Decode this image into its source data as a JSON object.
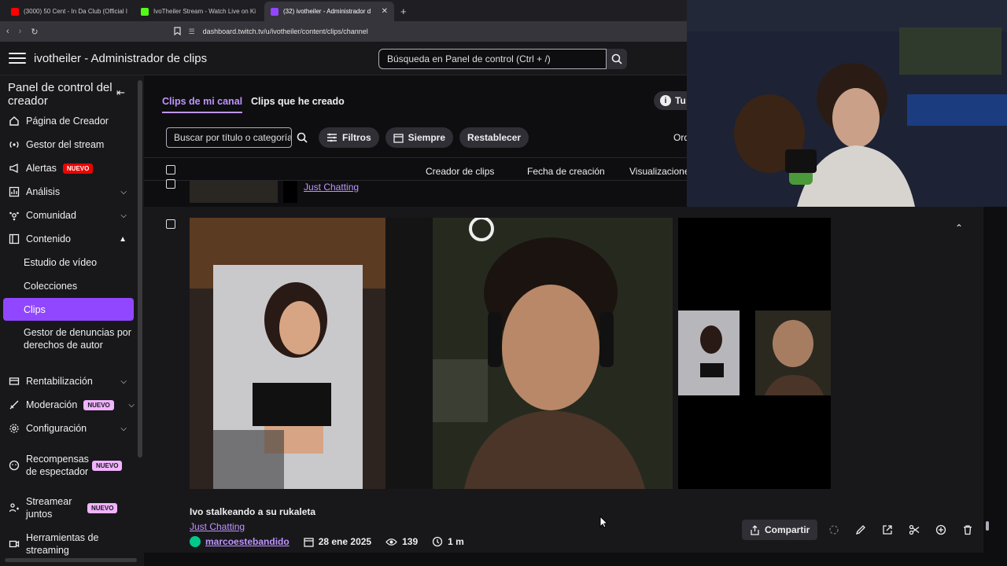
{
  "browser": {
    "tabs": [
      {
        "title": "(3000) 50 Cent - In Da Club (Official I",
        "fav_color": "#ff0000"
      },
      {
        "title": "IvoTheiler Stream - Watch Live on Ki",
        "fav_color": "#53fc18"
      },
      {
        "title": "(32) ivotheiler - Administrador d",
        "fav_color": "#9147ff"
      }
    ],
    "address": "dashboard.twitch.tv/u/ivotheiler/content/clips/channel"
  },
  "header": {
    "title": "ivotheiler - Administrador de clips",
    "search_placeholder": "Búsqueda en Panel de control (Ctrl + /)"
  },
  "sidebar": {
    "heading": "Panel de control del creador",
    "items": [
      {
        "label": "Página de Creador",
        "icon": "home-icon"
      },
      {
        "label": "Gestor del stream",
        "icon": "broadcast-icon"
      },
      {
        "label": "Alertas",
        "icon": "megaphone-icon",
        "badge": "NUEVO"
      },
      {
        "label": "Análisis",
        "icon": "chart-icon"
      },
      {
        "label": "Comunidad",
        "icon": "community-icon"
      },
      {
        "label": "Contenido",
        "icon": "content-icon"
      },
      {
        "label": "Rentabilización",
        "icon": "money-icon"
      },
      {
        "label": "Moderación",
        "icon": "sword-icon",
        "badge": "NUEVO"
      },
      {
        "label": "Configuración",
        "icon": "gear-icon"
      },
      {
        "label": "Recompensas de espectador",
        "icon": "reward-icon",
        "badge": "NUEVO"
      },
      {
        "label": "Streamear juntos",
        "icon": "together-icon",
        "badge": "NUEVO"
      },
      {
        "label": "Herramientas de streaming",
        "icon": "camera-icon"
      }
    ],
    "content_sub": [
      "Estudio de vídeo",
      "Colecciones",
      "Clips",
      "Gestor de denuncias por derechos de autor"
    ]
  },
  "main": {
    "tabs": [
      "Clips de mi canal",
      "Clips que he creado"
    ],
    "tutorial_label": "Tu",
    "filter_placeholder": "Buscar por título o categoría",
    "filters_label": "Filtros",
    "time_label": "Siempre",
    "reset_label": "Restablecer",
    "order_label": "Ord",
    "columns": [
      "Creador de clips",
      "Fecha de creación",
      "Visualizaciones"
    ],
    "prev_row_category": "Just Chatting"
  },
  "clip": {
    "title": "Ivo stalkeando a su rukaleta",
    "category": "Just Chatting",
    "creator": "marcoestebandido",
    "date": "28 ene 2025",
    "views": "139",
    "duration": "1 m",
    "share_label": "Compartir"
  },
  "colors": {
    "accent": "#9147ff",
    "link": "#bf94ff",
    "badge": "#f2b3ff"
  }
}
